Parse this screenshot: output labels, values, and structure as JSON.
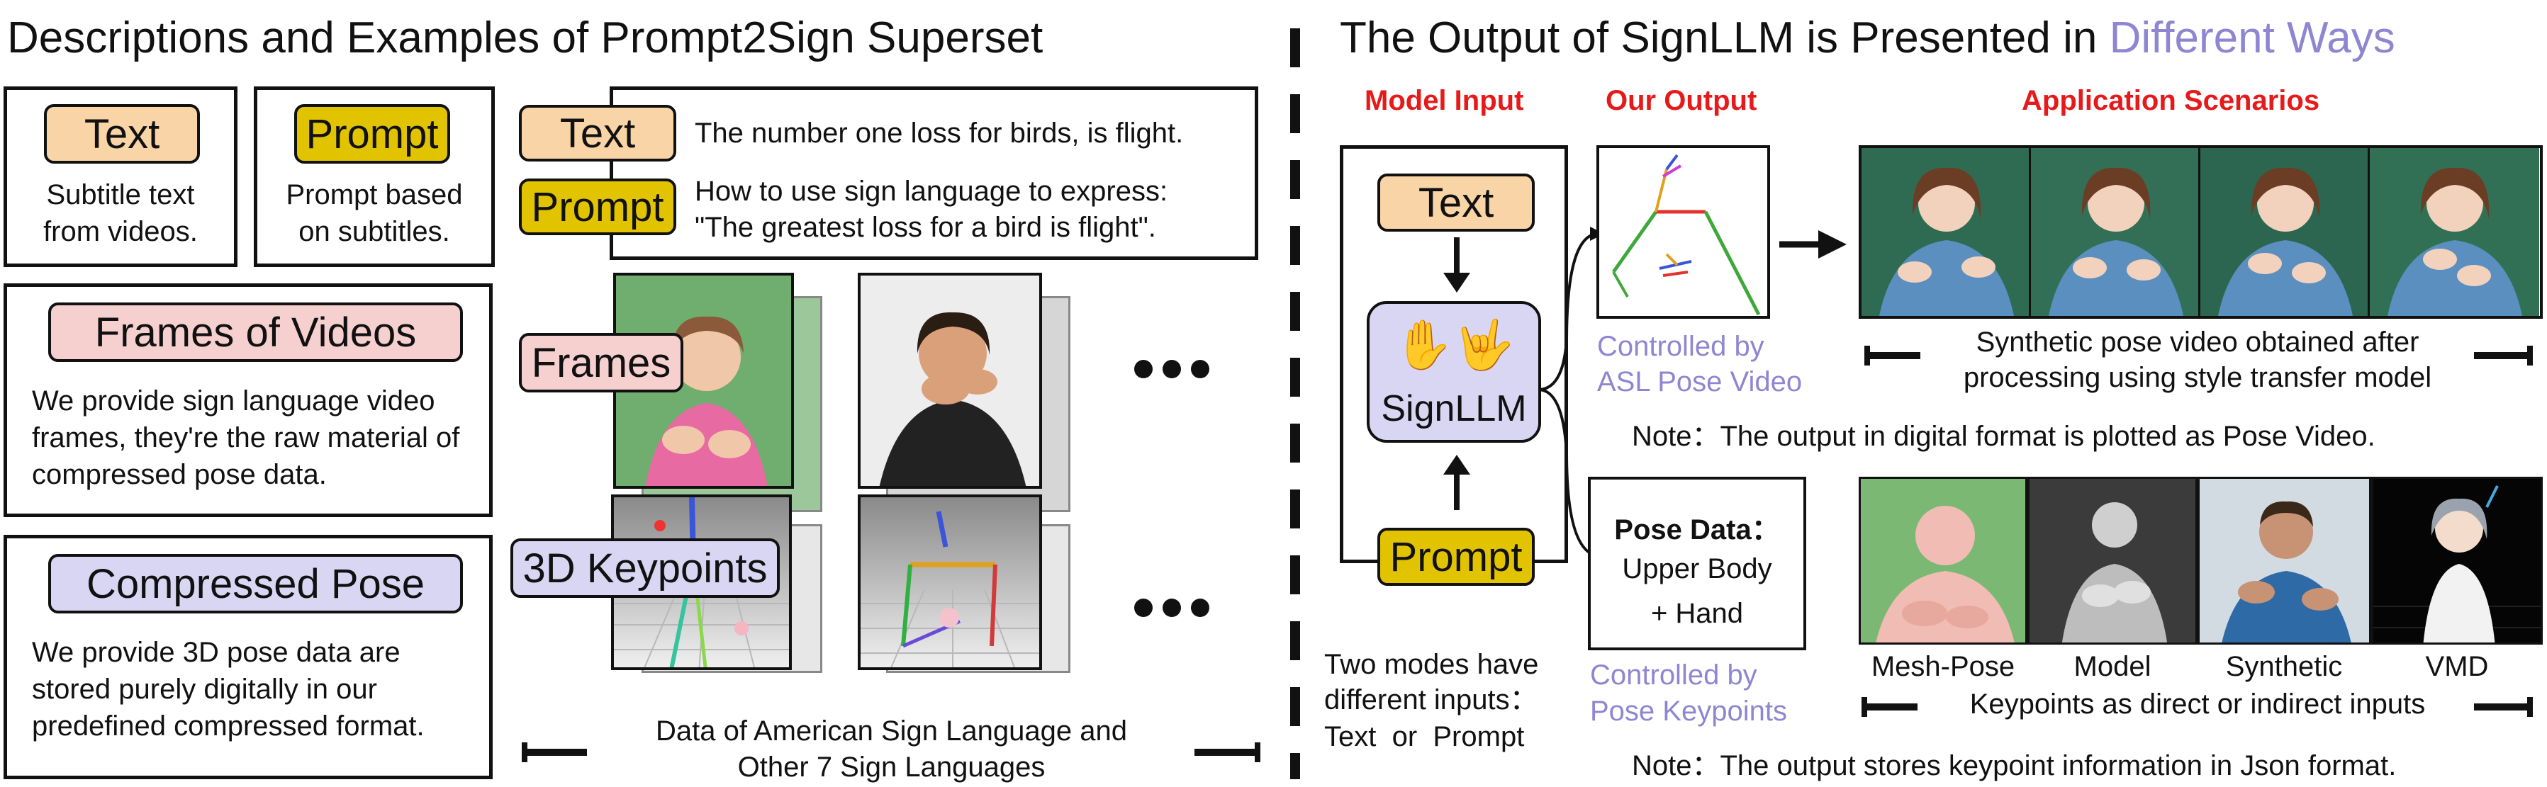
{
  "left": {
    "title": "Descriptions and Examples of Prompt2Sign Superset",
    "text_card": {
      "tag": "Text",
      "desc": "Subtitle text from videos."
    },
    "prompt_card": {
      "tag": "Prompt",
      "desc": "Prompt based on subtitles."
    },
    "example": {
      "text_tag": "Text",
      "prompt_tag": "Prompt",
      "text_line": "The number one loss for birds, is flight.",
      "prompt_line1": "How to use sign language to express:",
      "prompt_line2": "\"The greatest loss for a bird is flight\"."
    },
    "frames_card": {
      "tag": "Frames of Videos",
      "desc": "We provide sign language video frames, they're the raw material of compressed pose data."
    },
    "pose_card": {
      "tag": "Compressed Pose",
      "desc": "We provide 3D pose data are stored purely digitally in our predefined compressed format."
    },
    "frames_tag": "Frames",
    "keypoints_tag": "3D Keypoints",
    "data_caption_1": "Data of American Sign Language and",
    "data_caption_2": "Other 7 Sign Languages"
  },
  "right": {
    "title_main": "The Output of SignLLM is Presented in",
    "title_accent": "Different Ways",
    "col_model_input": "Model Input",
    "col_our_output": "Our Output",
    "col_app": "Application Scenarios",
    "text_tag": "Text",
    "prompt_tag": "Prompt",
    "model_name": "SignLLM",
    "model_icon": "sign-hands-icon",
    "controlled_1a": "Controlled by",
    "controlled_1b": "ASL Pose Video",
    "controlled_2a": "Controlled by",
    "controlled_2b": "Pose Keypoints",
    "pose_data_title": "Pose Data：",
    "pose_data_l1": "Upper Body",
    "pose_data_l2": "+ Hand",
    "synthetic_caption_1": "Synthetic pose video obtained after",
    "synthetic_caption_2": "processing using style transfer model",
    "note1": "Note：The output in digital format is plotted as Pose Video.",
    "two_modes_1": "Two modes have",
    "two_modes_2": "different inputs：",
    "two_modes_3": "Text  or  Prompt",
    "scene_labels": [
      "Mesh-Pose",
      "Model",
      "Synthetic",
      "VMD"
    ],
    "keypoints_caption": "Keypoints as direct or indirect inputs",
    "note2": "Note：The output stores keypoint information in Json format."
  },
  "colors": {
    "text_tag": "#f9d4a6",
    "prompt_tag": "#e2c300",
    "frames_tag": "#f6cfcf",
    "pose_tag": "#d9d6f4",
    "accent_red": "#e61a1a",
    "accent_purple": "#8f86d2"
  }
}
